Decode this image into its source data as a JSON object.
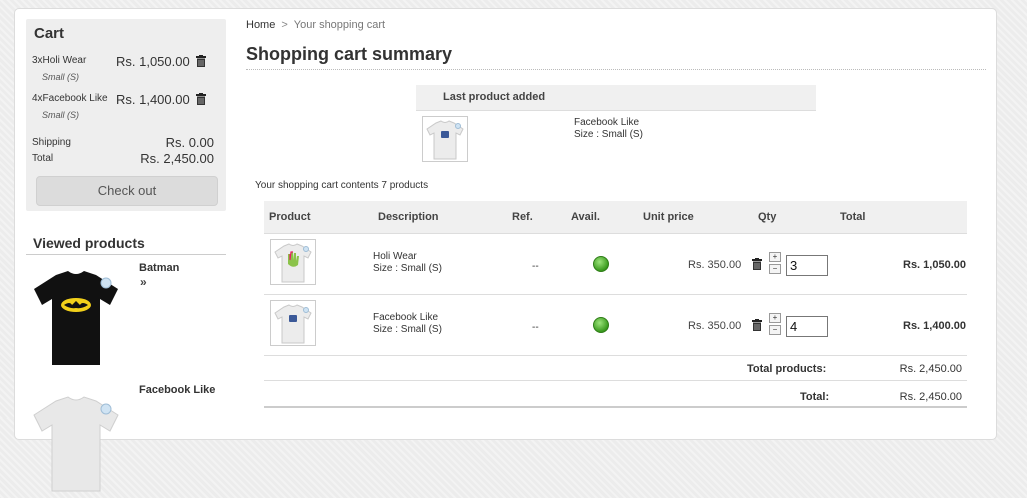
{
  "cart_block": {
    "title": "Cart",
    "items": [
      {
        "quantity_name": "3xHoli Wear",
        "price": "Rs. 1,050.00",
        "attributes": "Small (S)"
      },
      {
        "quantity_name": "4xFacebook Like",
        "price": "Rs. 1,400.00",
        "attributes": "Small (S)"
      }
    ],
    "shipping_label": "Shipping",
    "shipping_value": "Rs. 0.00",
    "total_label": "Total",
    "total_value": "Rs. 2,450.00",
    "checkout_label": "Check out"
  },
  "viewed": {
    "title": "Viewed products",
    "items": [
      {
        "name": "Batman",
        "more": "»"
      },
      {
        "name": "Facebook Like",
        "more": "»"
      }
    ]
  },
  "breadcrumb": {
    "home": "Home",
    "separator": ">",
    "current": "Your shopping cart"
  },
  "page_title": "Shopping cart summary",
  "last_added": {
    "heading": "Last product added",
    "name": "Facebook Like",
    "attributes": "Size : Small (S)"
  },
  "cart_count_text": "Your shopping cart contents 7 products",
  "table": {
    "headers": {
      "product": "Product",
      "description": "Description",
      "ref": "Ref.",
      "avail": "Avail.",
      "unit_price": "Unit price",
      "qty": "Qty",
      "total": "Total"
    },
    "rows": [
      {
        "name": "Holi Wear",
        "attributes": "Size : Small (S)",
        "ref": "--",
        "unit_price": "Rs. 350.00",
        "qty": "3",
        "total": "Rs. 1,050.00"
      },
      {
        "name": "Facebook Like",
        "attributes": "Size : Small (S)",
        "ref": "--",
        "unit_price": "Rs. 350.00",
        "qty": "4",
        "total": "Rs. 1,400.00"
      }
    ],
    "step_up": "+",
    "step_down": "−",
    "total_products_label": "Total products:",
    "total_products_value": "Rs. 2,450.00",
    "grand_total_label": "Total:",
    "grand_total_value": "Rs. 2,450.00"
  },
  "colors": {
    "avail_green": "#3a9a1e",
    "header_bg": "#f0f0f0",
    "cart_bg": "#eeeeee"
  }
}
